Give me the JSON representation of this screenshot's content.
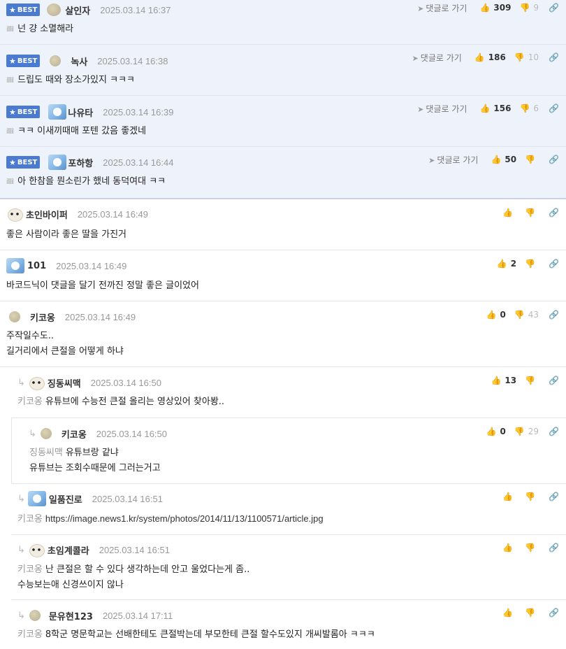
{
  "best_badge": "BEST",
  "goto_label": "댓글로 가기",
  "level_mark": "illllil",
  "best_comments": [
    {
      "nick": "살인자",
      "date": "2025.03.14 16:37",
      "text": "넌 걍 소멸해라",
      "up": "309",
      "down": "9"
    },
    {
      "nick": "녹사",
      "date": "2025.03.14 16:38",
      "text": "드립도 때와 장소가있지 ㅋㅋㅋ",
      "up": "186",
      "down": "10"
    },
    {
      "nick": "나유타",
      "date": "2025.03.14 16:39",
      "text": "ㅋㅋ 이새끼때매 포텐 갔음 좋겠네",
      "up": "156",
      "down": "6"
    },
    {
      "nick": "포하항",
      "date": "2025.03.14 16:44",
      "text": "아 한참을 뭔소린가 했네 동덕여대 ㅋㅋ",
      "up": "50",
      "down": ""
    }
  ],
  "comments": [
    {
      "nick": "초인바이퍼",
      "date": "2025.03.14 16:49",
      "lines": [
        "좋은 사람이라 좋은 딸을 가진거"
      ],
      "up": "",
      "down": ""
    },
    {
      "nick": "101",
      "date": "2025.03.14 16:49",
      "lines": [
        "바코드닉이 댓글을 달기 전까진 정말 좋은 글이었어"
      ],
      "up": "2",
      "down": ""
    },
    {
      "nick": "키코옹",
      "date": "2025.03.14 16:49",
      "lines": [
        "주작일수도..",
        "길거리에서 큰절을 어떻게 하냐"
      ],
      "up": "0",
      "down": "43"
    },
    {
      "nick": "징동씨맥",
      "date": "2025.03.14 16:50",
      "to": "키코옹",
      "lines": [
        "유튜브에 수능전 큰절 올리는 영상있어 찾아봥.."
      ],
      "up": "13",
      "down": ""
    },
    {
      "nick": "키코옹",
      "date": "2025.03.14 16:50",
      "to": "징동씨맥",
      "lines": [
        "유튜브랑 같냐",
        "유튜브는 조회수때문에 그러는거고"
      ],
      "up": "0",
      "down": "29"
    },
    {
      "nick": "일품진로",
      "date": "2025.03.14 16:51",
      "to": "키코옹",
      "lines": [
        "https://image.news1.kr/system/photos/2014/11/13/1100571/article.jpg"
      ],
      "up": "",
      "down": ""
    },
    {
      "nick": "초임계콜라",
      "date": "2025.03.14 16:51",
      "to": "키코옹",
      "lines": [
        "난 큰절은 할 수 있다 생각하는데 안고 울었다는게 좀..",
        "수능보는애 신경쓰이지 않나"
      ],
      "up": "",
      "down": ""
    },
    {
      "nick": "문유현123",
      "date": "2025.03.14 17:11",
      "to": "키코옹",
      "lines": [
        "8학군 명문학교는 선배한테도 큰절박는데 부모한테 큰절 할수도있지 개씨발롬아 ㅋㅋㅋ"
      ],
      "up": "",
      "down": ""
    }
  ]
}
